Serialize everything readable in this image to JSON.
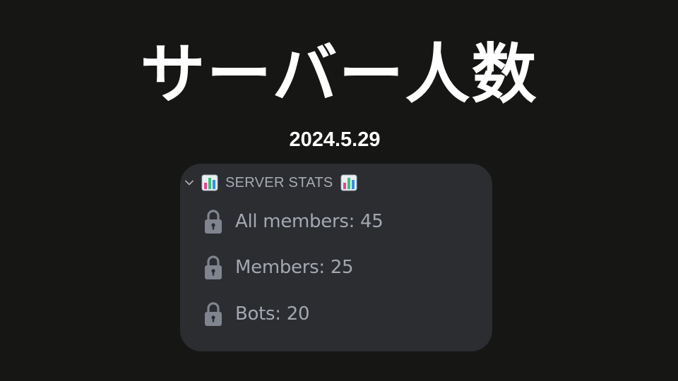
{
  "title": "サーバー人数",
  "date": "2024.5.29",
  "category": {
    "name": "SERVER STATS",
    "expanded": true,
    "icon": "bar-chart-emoji",
    "toggle_icon": "chevron-down-icon"
  },
  "channels": [
    {
      "label": "All members: 45",
      "icon": "lock-icon"
    },
    {
      "label": "Members: 25",
      "icon": "lock-icon"
    },
    {
      "label": "Bots: 20",
      "icon": "lock-icon"
    }
  ],
  "colors": {
    "background": "#161614",
    "panel": "#2b2d31",
    "channel_text": "#a3a8b0",
    "title_text": "#ffffff"
  }
}
